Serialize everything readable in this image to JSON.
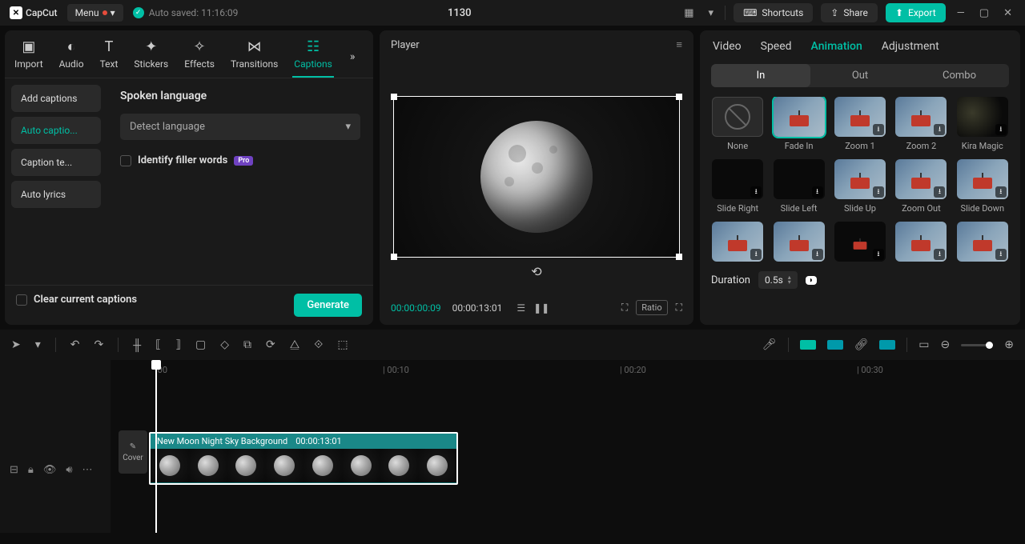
{
  "app": {
    "name": "CapCut",
    "menu": "Menu",
    "autosave": "Auto saved: 11:16:09",
    "title": "1130"
  },
  "titleButtons": {
    "shortcuts": "Shortcuts",
    "share": "Share",
    "export": "Export"
  },
  "mediaTabs": {
    "import": "Import",
    "audio": "Audio",
    "text": "Text",
    "stickers": "Stickers",
    "effects": "Effects",
    "transitions": "Transitions",
    "captions": "Captions"
  },
  "captionsSidebar": {
    "add": "Add captions",
    "auto": "Auto captio...",
    "template": "Caption te...",
    "lyrics": "Auto lyrics"
  },
  "captionsPane": {
    "heading": "Spoken language",
    "detect": "Detect language",
    "filler": "Identify filler words",
    "pro": "Pro",
    "clear": "Clear current captions",
    "generate": "Generate"
  },
  "player": {
    "label": "Player",
    "current": "00:00:00:09",
    "total": "00:00:13:01",
    "ratio": "Ratio"
  },
  "rightTabs": {
    "video": "Video",
    "speed": "Speed",
    "animation": "Animation",
    "adjustment": "Adjustment"
  },
  "segTabs": {
    "in": "In",
    "out": "Out",
    "combo": "Combo"
  },
  "anims": {
    "none": "None",
    "fadein": "Fade In",
    "zoom1": "Zoom 1",
    "zoom2": "Zoom 2",
    "kira": "Kira Magic",
    "slideright": "Slide Right",
    "slideleft": "Slide Left",
    "slideup": "Slide Up",
    "zoomout": "Zoom Out",
    "slidedown": "Slide Down"
  },
  "duration": {
    "label": "Duration",
    "value": "0.5s"
  },
  "ruler": {
    "t0": ":00",
    "t10": "00:10",
    "t20": "00:20",
    "t30": "00:30"
  },
  "clip": {
    "name": "New Moon Night Sky Background",
    "dur": "00:00:13:01"
  },
  "cover": "Cover"
}
